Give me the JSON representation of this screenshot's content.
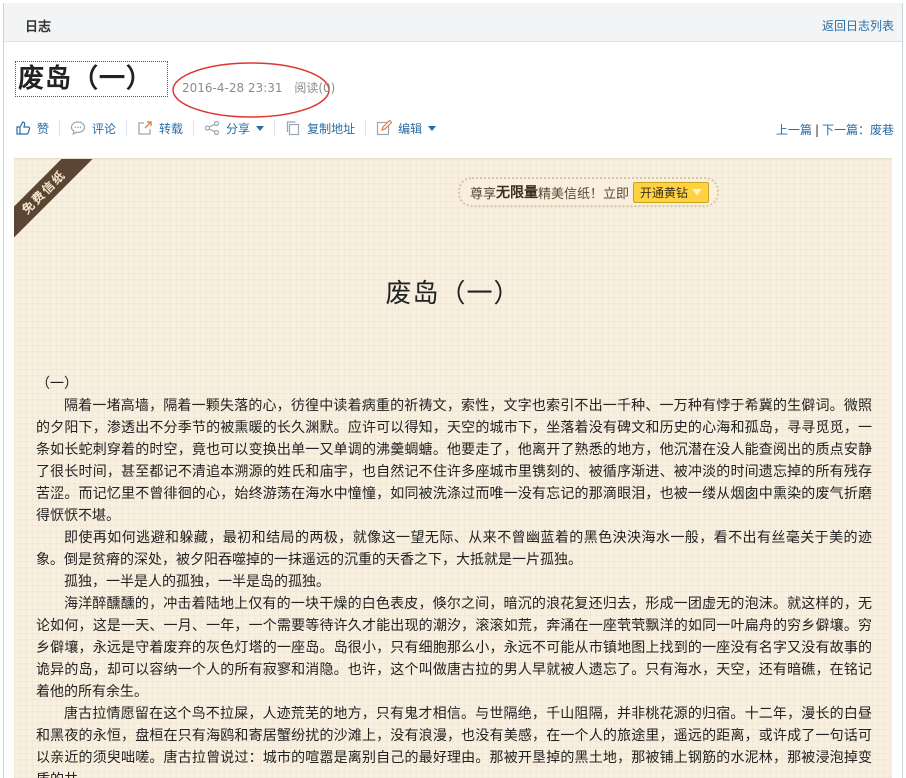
{
  "header": {
    "title": "日志",
    "back_link": "返回日志列表"
  },
  "post": {
    "title": "废岛（一）",
    "date": "2016-4-28 23:31",
    "reads": "阅读(0)"
  },
  "actions": {
    "like": "赞",
    "comment": "评论",
    "repost": "转载",
    "share": "分享",
    "copy_link": "复制地址",
    "edit": "编辑"
  },
  "pager": {
    "prev": "上一篇",
    "separator": "|",
    "next": "下一篇：废巷"
  },
  "paper": {
    "ribbon": "免费信纸",
    "promo_prefix": "尊享",
    "promo_bold": "无限量",
    "promo_suffix": "精美信纸！立即",
    "promo_button": "开通黄钻",
    "doc_title": "废岛（一）"
  },
  "content": {
    "paragraphs": [
      "（一）",
      "隔着一堵高墙，隔着一颗失落的心，彷徨中读着病重的祈祷文，索性，文字也索引不出一千种、一万种有悖于希冀的生僻词。微照的夕阳下，渗透出不分季节的被熏暖的长久渊默。应许可以得知，天空的城市下，坐落着没有碑文和历史的心海和孤岛，寻寻觅觅，一条如长蛇刺穿着的时空，竟也可以变换出单一又单调的沸羹蜩螗。他要走了，他离开了熟悉的地方，他沉潜在没人能查阅出的质点安静了很长时间，甚至都记不清追本溯源的姓氏和庙宇，也自然记不住许多座城市里镌刻的、被循序渐进、被冲淡的时间遗忘掉的所有残存苦涩。而记忆里不曾徘徊的心，始终游荡在海水中憧憧，如同被洗涤过而唯一没有忘记的那滴眼泪，也被一缕从烟囱中熏染的废气折磨得恹恹不堪。",
      "即使再如何逃避和躲藏，最初和结局的两极，就像这一望无际、从来不曾幽蓝着的黑色泱泱海水一般，看不出有丝毫关于美的迹象。倒是贫瘠的深处，被夕阳吞噬掉的一抹遥远的沉重的天香之下，大抵就是一片孤独。",
      "孤独，一半是人的孤独，一半是岛的孤独。",
      "海洋醉醺醺的，冲击着陆地上仅有的一块干燥的白色表皮，倏尔之间，暗沉的浪花复还归去，形成一团虚无的泡沫。就这样的，无论如何，这是一天、一月、一年，一个需要等待许久才能出现的潮汐，滚滚如荒，奔涌在一座茕茕飘洋的如同一叶扁舟的穷乡僻壤。穷乡僻壤，永远是守着废弃的灰色灯塔的一座岛。岛很小，只有细胞那么小，永远不可能从市镇地图上找到的一座没有名字又没有故事的诡异的岛，却可以容纳一个人的所有寂寥和消隐。也许，这个叫做唐古拉的男人早就被人遗忘了。只有海水，天空，还有暗礁，在铭记着他的所有余生。",
      "唐古拉情愿留在这个鸟不拉屎，人迹荒芜的地方，只有鬼才相信。与世隔绝，千山阻隔，并非桃花源的归宿。十二年，漫长的白昼和黑夜的永恒，盘桓在只有海鸥和寄居蟹纷扰的沙滩上，没有浪漫，也没有美感，在一个人的旅途里，遥远的距离，或许成了一句话可以亲近的须臾咄嗟。唐古拉曾说过：城市的喧嚣是离别自己的最好理由。那被开垦掉的黑土地，那被铺上钢筋的水泥林，那被浸泡掉变质的井"
    ]
  }
}
